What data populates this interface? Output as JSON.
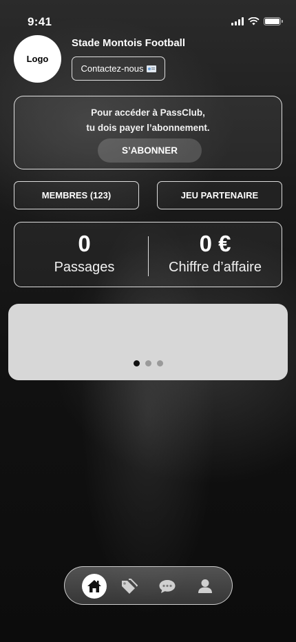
{
  "status_bar": {
    "time": "9:41"
  },
  "header": {
    "logo_label": "Logo",
    "club_name": "Stade Montois Football",
    "contact_label": "Contactez-nous"
  },
  "subscription": {
    "line1": "Pour accéder à  PassClub,",
    "line2": "tu dois payer l’abonnement.",
    "button_label": "S’ABONNER"
  },
  "actions": {
    "members_label": "MEMBRES (123)",
    "partner_label": "JEU PARTENAIRE"
  },
  "stats": {
    "passages_value": "0",
    "passages_label": "Passages",
    "revenue_value": "0 €",
    "revenue_label": "Chiffre d’affaire"
  },
  "carousel": {
    "page_count": 3,
    "active_index": 0
  },
  "tabbar": {
    "items": [
      {
        "icon": "home-icon",
        "active": true
      },
      {
        "icon": "tags-icon",
        "active": false
      },
      {
        "icon": "chat-icon",
        "active": false
      },
      {
        "icon": "profile-icon",
        "active": false
      }
    ]
  },
  "colors": {
    "background": "#111111",
    "carousel": "#d7d7d7",
    "accent": "#ffffff"
  }
}
